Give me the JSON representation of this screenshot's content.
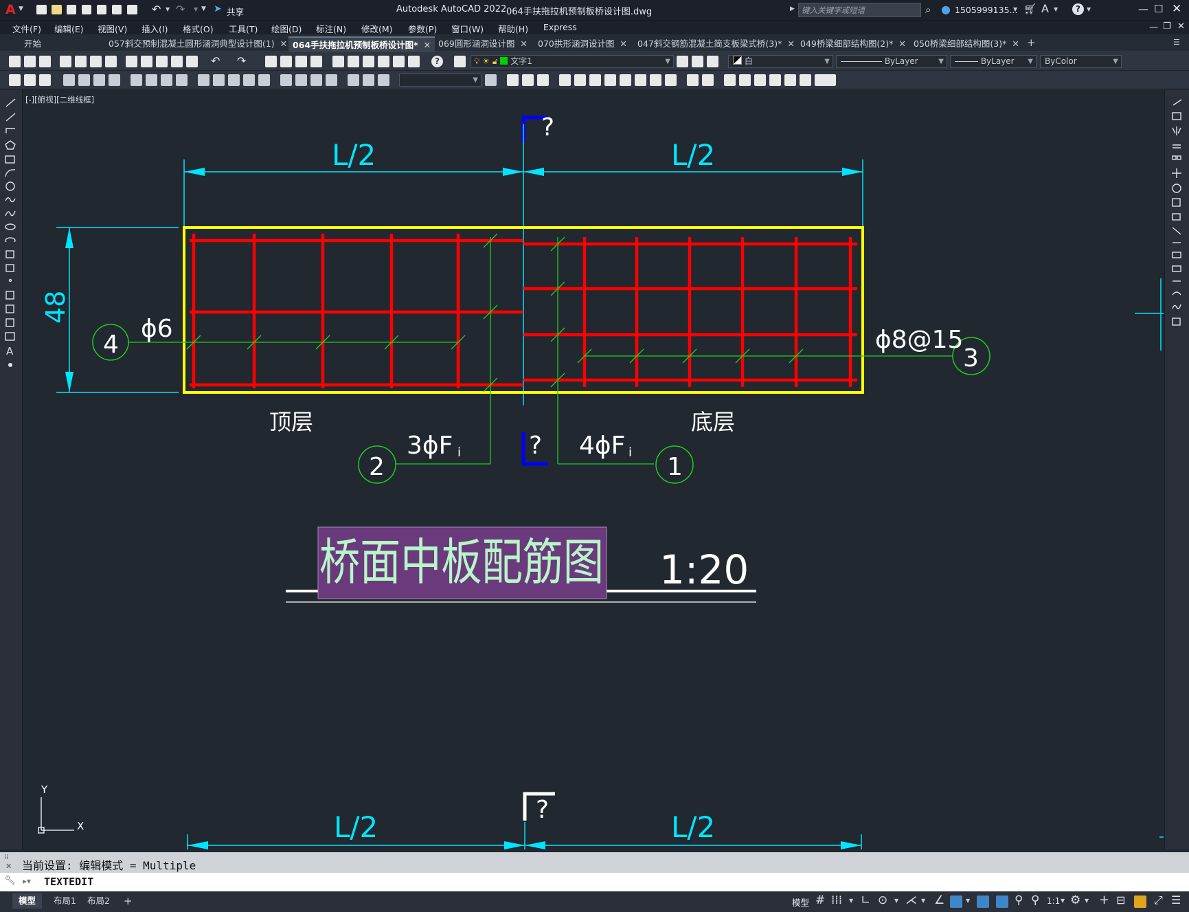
{
  "app": {
    "logo": "A",
    "title": "Autodesk AutoCAD 2022",
    "filename": "064手扶拖拉机预制板桥设计图.dwg",
    "share_label": "共享",
    "search_placeholder": "键入关键字或短语",
    "user": "1505999135...",
    "window_controls": [
      "minimize-icon",
      "maximize-icon",
      "close-icon"
    ]
  },
  "menu": [
    "文件(F)",
    "编辑(E)",
    "视图(V)",
    "插入(I)",
    "格式(O)",
    "工具(T)",
    "绘图(D)",
    "标注(N)",
    "修改(M)",
    "参数(P)",
    "窗口(W)",
    "帮助(H)",
    "Express"
  ],
  "tabs": [
    {
      "label": "开始",
      "closable": false,
      "active": false
    },
    {
      "label": "057斜交预制混凝土圆形涵洞典型设计图(1)",
      "closable": true,
      "active": false
    },
    {
      "label": "064手扶拖拉机预制板桥设计图*",
      "closable": true,
      "active": true
    },
    {
      "label": "069圆形涵洞设计图",
      "closable": true,
      "active": false
    },
    {
      "label": "070拱形涵洞设计图",
      "closable": true,
      "active": false
    },
    {
      "label": "047斜交钢筋混凝土简支板梁式桥(3)*",
      "closable": true,
      "active": false
    },
    {
      "label": "049桥梁细部结构图(2)*",
      "closable": true,
      "active": false
    },
    {
      "label": "050桥梁细部结构图(3)*",
      "closable": true,
      "active": false
    }
  ],
  "toolbar": {
    "layer_name": "文字1",
    "color_name": "白",
    "linetype": "ByLayer",
    "lineweight": "ByLayer",
    "plotstyle": "ByColor"
  },
  "viewport_label": "[-][俯视][二维线框]",
  "drawing": {
    "dim_top_left": "L/2",
    "dim_top_right": "L/2",
    "dim_height": "48",
    "section_mark_top": "?",
    "section_mark_bottom": "?",
    "section_mark_lower": "?",
    "label_phi6": "ϕ6",
    "label_phi8": "ϕ8@15",
    "callout_1": "1",
    "callout_2": "2",
    "callout_3": "3",
    "callout_4": "4",
    "label_3phi": "3ϕF",
    "label_3phi_sub": "i",
    "label_4phi": "4ϕF",
    "label_4phi_sub": "i",
    "top_layer": "顶层",
    "bottom_layer": "底层",
    "main_title": "桥面中板配筋图",
    "scale": "1:20",
    "dim_lower_left": "L/2",
    "dim_lower_right": "L/2",
    "ucs_x": "X",
    "ucs_y": "Y"
  },
  "command": {
    "history": "当前设置: 编辑模式 = Multiple",
    "current": "TEXTEDIT"
  },
  "layout_tabs": [
    "模型",
    "布局1",
    "布局2",
    "+"
  ],
  "status": {
    "model_label": "模型",
    "scale": "1:1"
  },
  "colors": {
    "canvas_bg": "#212830",
    "outline": "#ffff00",
    "rebar": "#ff0000",
    "dimension": "#00e5ff",
    "leader": "#22cc22",
    "text": "#ffffff",
    "section": "#0000ff",
    "title_fill": "#6a3a7c",
    "title_text": "#b8f5c8"
  }
}
